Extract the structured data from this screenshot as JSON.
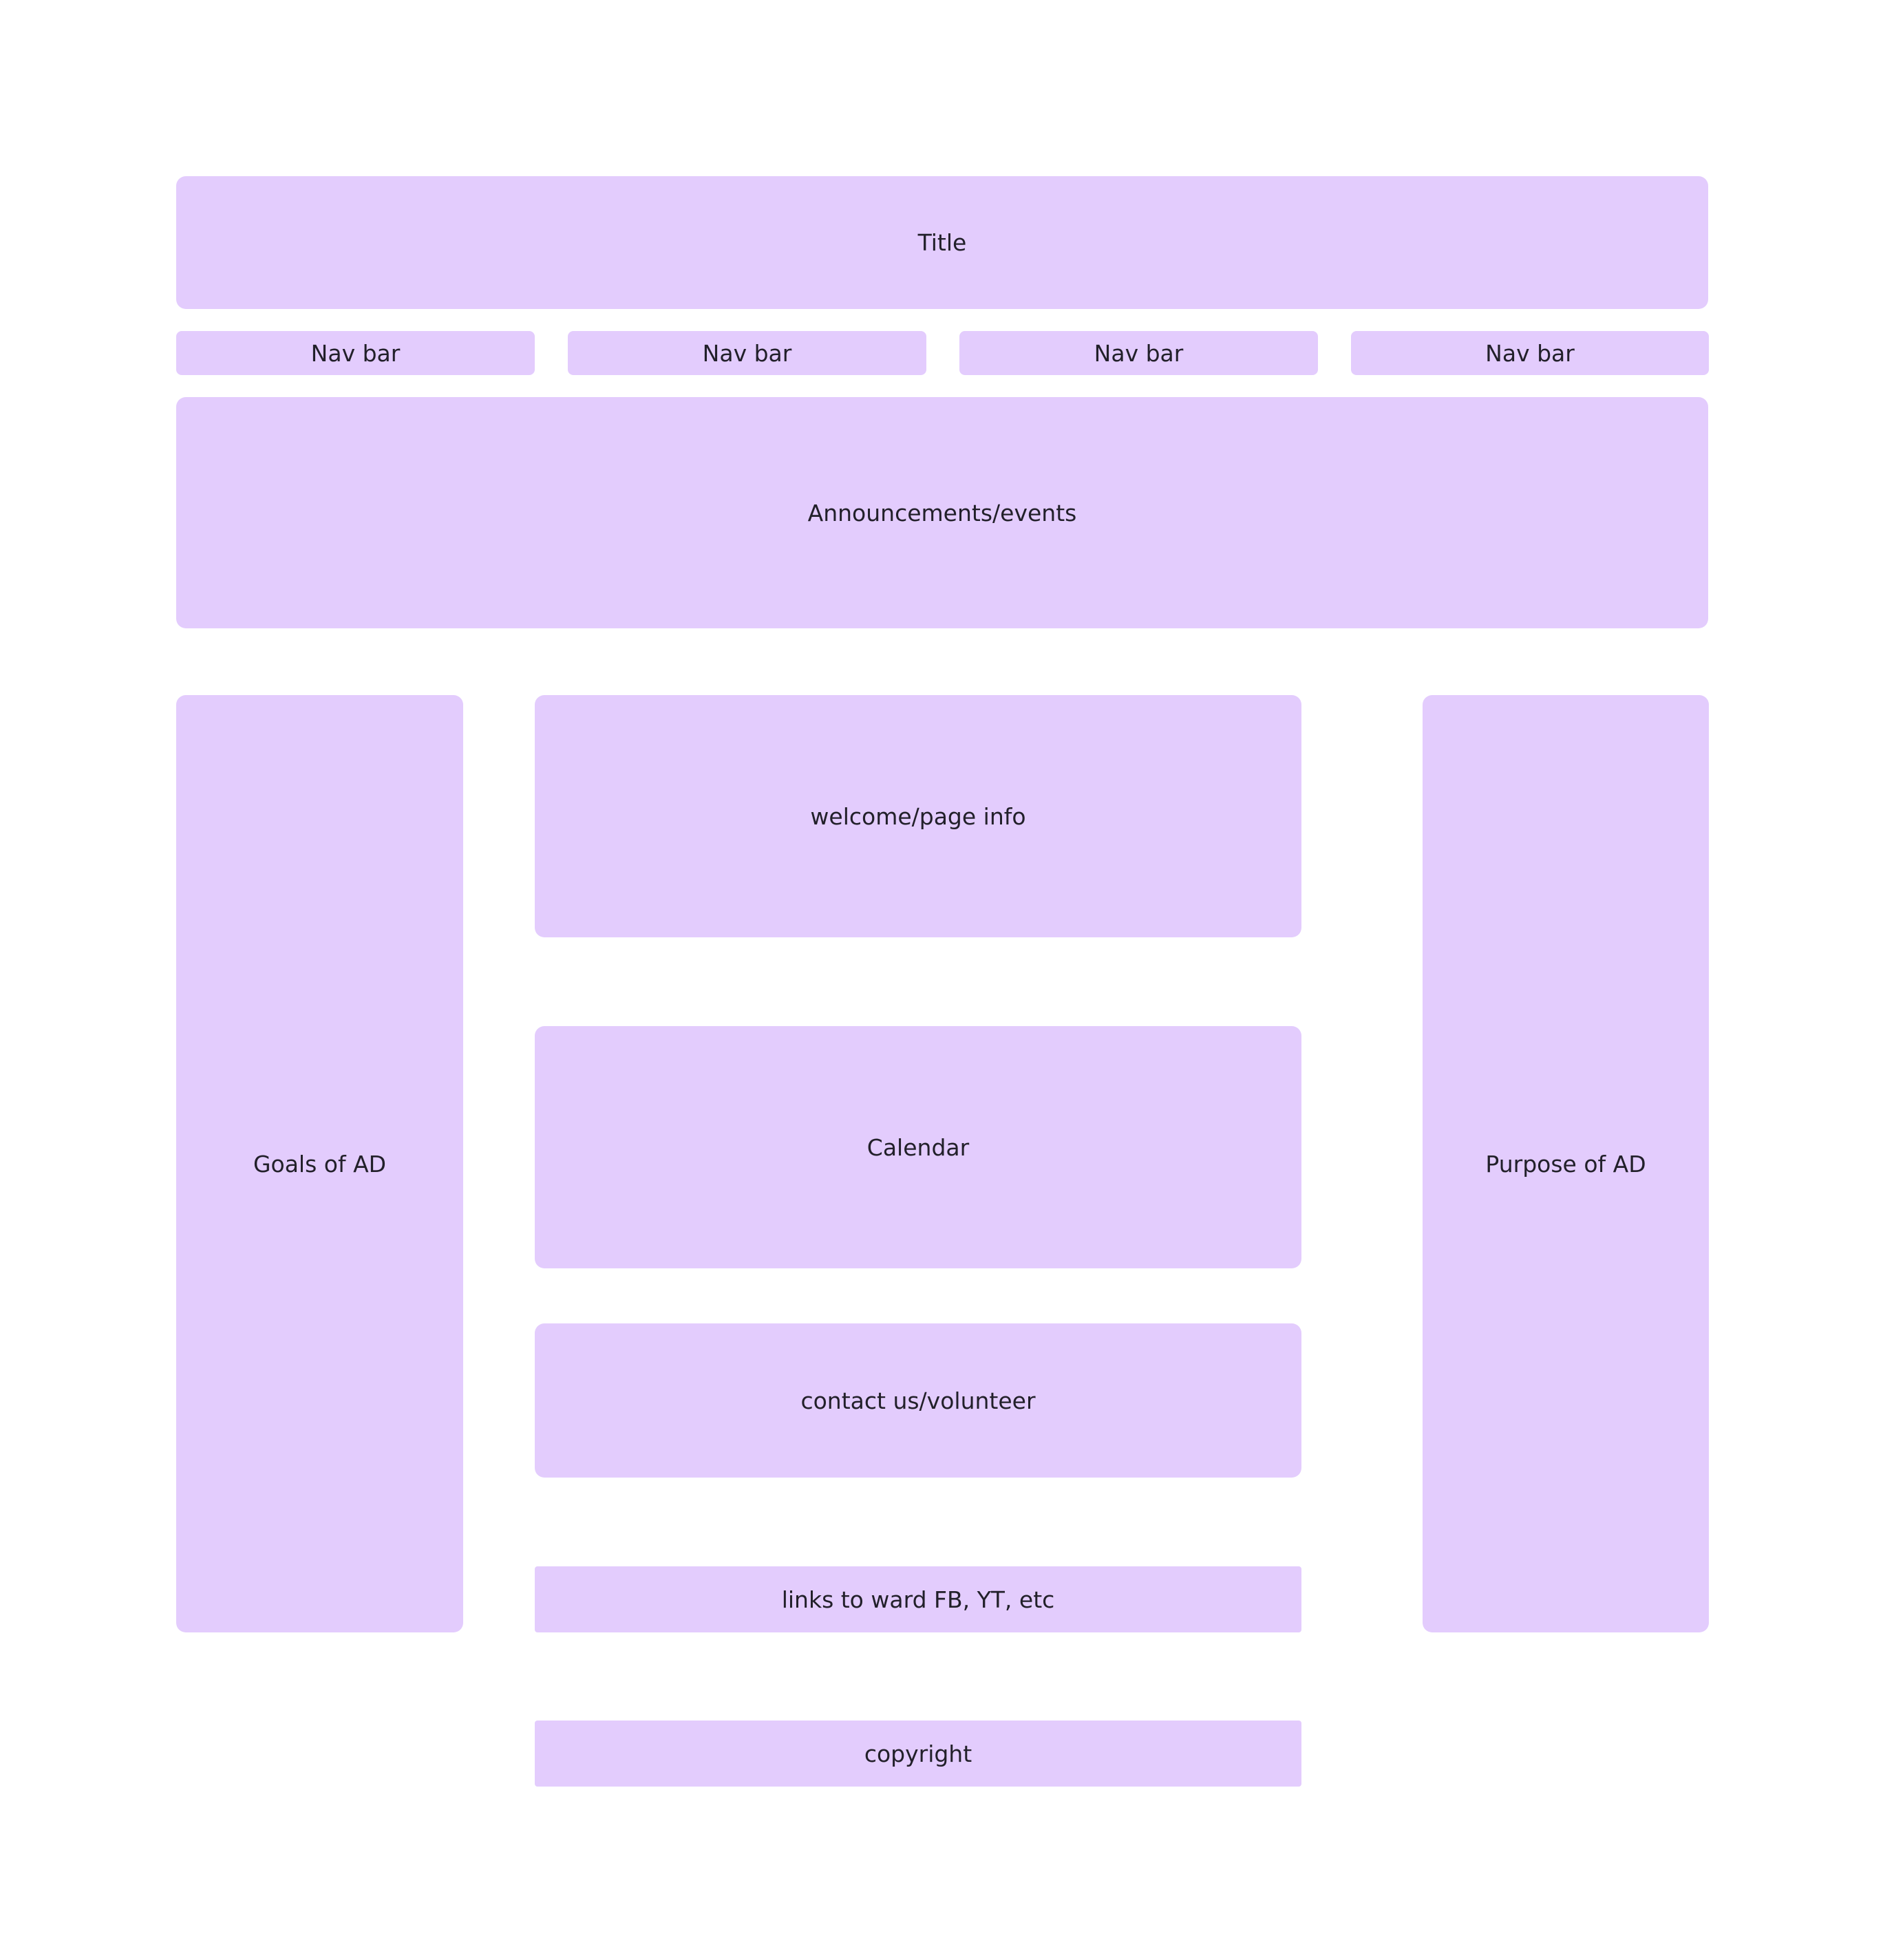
{
  "wireframe": {
    "title": "Title",
    "nav": [
      "Nav bar",
      "Nav bar",
      "Nav bar",
      "Nav bar"
    ],
    "announcements": "Announcements/events",
    "left_sidebar": "Goals of AD",
    "right_sidebar": "Purpose of AD",
    "welcome": "welcome/page info",
    "calendar": "Calendar",
    "contact": "contact us/volunteer",
    "links": "links to ward FB, YT, etc",
    "copyright": "copyright"
  },
  "colors": {
    "block_fill": "#e3ccfd",
    "text": "#22202a",
    "background": "#ffffff"
  }
}
